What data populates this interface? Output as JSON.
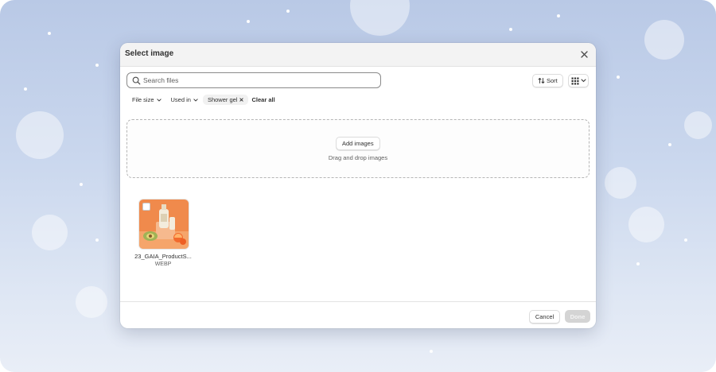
{
  "modal": {
    "title": "Select image"
  },
  "search": {
    "placeholder": "Search files",
    "value": ""
  },
  "toolbar": {
    "sort_label": "Sort"
  },
  "filters": [
    {
      "label": "File size",
      "icon": "chevron-down-icon"
    },
    {
      "label": "Used in",
      "icon": "chevron-down-icon"
    },
    {
      "label": "Shower gel",
      "icon": "remove-x-icon"
    }
  ],
  "clear_all_label": "Clear all",
  "dropzone": {
    "button_label": "Add images",
    "hint": "Drag and drop images"
  },
  "files": [
    {
      "name": "23_GAIA_ProductS...",
      "type": "WEBP",
      "checked": false
    }
  ],
  "footer": {
    "cancel_label": "Cancel",
    "done_label": "Done",
    "done_enabled": false
  },
  "colors": {
    "text": "#303030",
    "subdued": "#616161",
    "thumb_bg": "#f18a4c"
  }
}
